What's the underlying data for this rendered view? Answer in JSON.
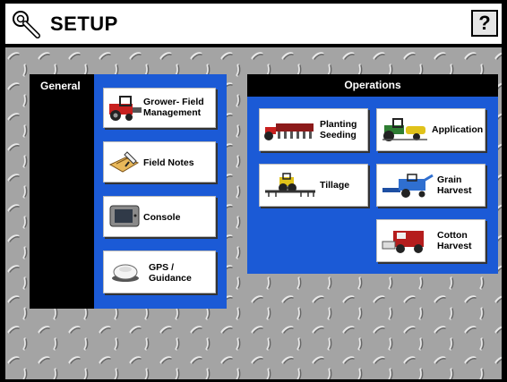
{
  "header": {
    "title": "SETUP",
    "help_label": "?"
  },
  "general": {
    "label": "General",
    "buttons": [
      {
        "label": "Grower- Field\nManagement",
        "icon": "tractor-icon"
      },
      {
        "label": "Field Notes",
        "icon": "field-notes-icon"
      },
      {
        "label": "Console",
        "icon": "console-icon"
      },
      {
        "label": "GPS /\nGuidance",
        "icon": "gps-receiver-icon"
      }
    ]
  },
  "operations": {
    "label": "Operations",
    "buttons": [
      {
        "label": "Planting\nSeeding",
        "icon": "planter-icon"
      },
      {
        "label": "Application",
        "icon": "sprayer-icon"
      },
      {
        "label": "Tillage",
        "icon": "tillage-icon"
      },
      {
        "label": "Grain\nHarvest",
        "icon": "combine-icon"
      },
      {
        "label": "Cotton\nHarvest",
        "icon": "cotton-picker-icon"
      }
    ]
  },
  "colors": {
    "panel_blue": "#1b5ad6",
    "panel_black": "#000000",
    "button_white": "#ffffff"
  }
}
